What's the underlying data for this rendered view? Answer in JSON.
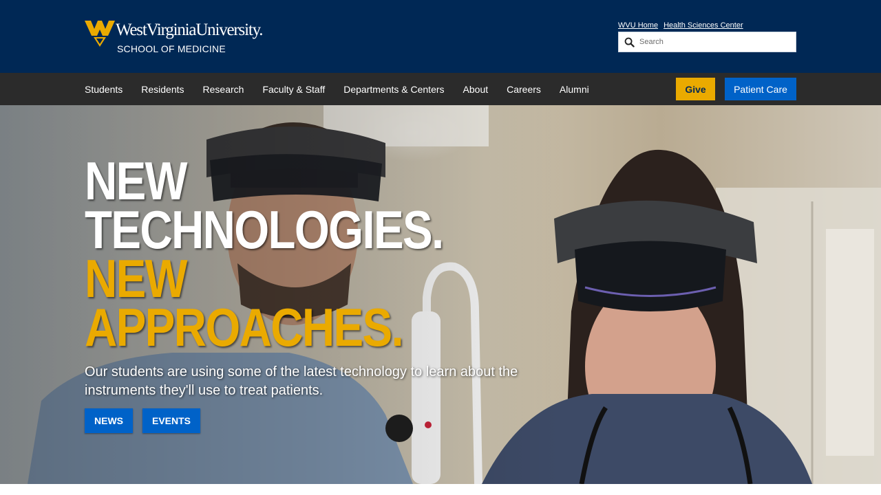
{
  "brand": {
    "wordmark": "WestVirginiaUniversity.",
    "school": "SCHOOL OF MEDICINE",
    "colors": {
      "navy": "#002855",
      "gold": "#eaaa00",
      "blue": "#0062c8",
      "nav": "#2b2b2b"
    },
    "mark_icon": "flying-wv-logo-icon"
  },
  "utility": {
    "links": [
      {
        "label": "WVU Home"
      },
      {
        "label": "Health Sciences Center"
      }
    ]
  },
  "search": {
    "placeholder": "Search",
    "value": "",
    "icon": "search-icon"
  },
  "nav": {
    "items": [
      {
        "label": "Students"
      },
      {
        "label": "Residents"
      },
      {
        "label": "Research"
      },
      {
        "label": "Faculty & Staff"
      },
      {
        "label": "Departments & Centers"
      },
      {
        "label": "About"
      },
      {
        "label": "Careers"
      },
      {
        "label": "Alumni"
      }
    ],
    "give_label": "Give",
    "patient_care_label": "Patient Care"
  },
  "hero": {
    "headline_lines": [
      {
        "text": "NEW",
        "color": "white"
      },
      {
        "text": "TECHNOLOGIES.",
        "color": "white"
      },
      {
        "text": "NEW",
        "color": "gold"
      },
      {
        "text": "APPROACHES.",
        "color": "gold"
      }
    ],
    "copy": "Our students are using some of the latest technology to learn about the instruments they'll use to treat patients.",
    "buttons": [
      {
        "label": "NEWS"
      },
      {
        "label": "EVENTS"
      }
    ]
  }
}
